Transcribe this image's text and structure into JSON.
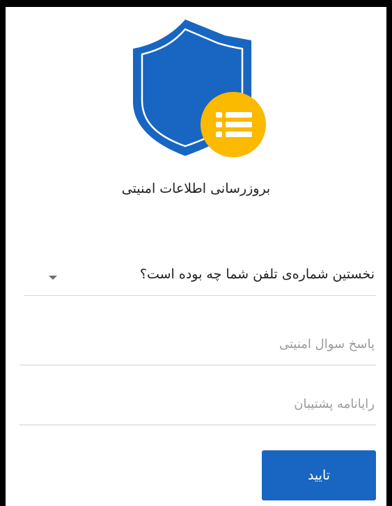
{
  "header": {
    "logo_icon": "shield-with-list-badge-icon",
    "title": "بروزرسانی اطلاعات امنیتی"
  },
  "form": {
    "security_question": {
      "selected": "نخستین شماره‌ی تلفن شما چه بوده است؟",
      "caret_icon": "dropdown-caret-icon"
    },
    "answer": {
      "value": "",
      "placeholder": "پاسخ سوال امنیتی"
    },
    "backup_email": {
      "value": "",
      "placeholder": "رایانامه پشتیبان"
    },
    "submit_label": "تایید"
  },
  "colors": {
    "shield_blue": "#1866c2",
    "badge_yellow": "#fbb900",
    "button_blue": "#1866c2",
    "background": "#ffffff",
    "frame_border": "#000000"
  }
}
